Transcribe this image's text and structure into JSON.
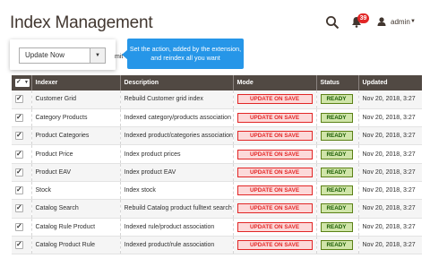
{
  "header": {
    "title": "Index Management",
    "notifications_count": "39",
    "user_name": "admin"
  },
  "actions": {
    "selected": "Update Now",
    "submit_partial": "mit",
    "tooltip": "Set the action, added by the extension, and reindex all you want"
  },
  "grid": {
    "columns": [
      "Indexer",
      "Description",
      "Mode",
      "Status",
      "Updated"
    ],
    "rows": [
      {
        "indexer": "Customer Grid",
        "description": "Rebuild Customer grid index",
        "mode": "UPDATE ON SAVE",
        "status": "READY",
        "updated": "Nov 20, 2018, 3:27"
      },
      {
        "indexer": "Category Products",
        "description": "Indexed category/products association",
        "mode": "UPDATE ON SAVE",
        "status": "READY",
        "updated": "Nov 20, 2018, 3:27"
      },
      {
        "indexer": "Product Categories",
        "description": "Indexed product/categories association",
        "mode": "UPDATE ON SAVE",
        "status": "READY",
        "updated": "Nov 20, 2018, 3:27"
      },
      {
        "indexer": "Product Price",
        "description": "Index product prices",
        "mode": "UPDATE ON SAVE",
        "status": "READY",
        "updated": "Nov 20, 2018, 3:27"
      },
      {
        "indexer": "Product EAV",
        "description": "Index product EAV",
        "mode": "UPDATE ON SAVE",
        "status": "READY",
        "updated": "Nov 20, 2018, 3:27"
      },
      {
        "indexer": "Stock",
        "description": "Index stock",
        "mode": "UPDATE ON SAVE",
        "status": "READY",
        "updated": "Nov 20, 2018, 3:27"
      },
      {
        "indexer": "Catalog Search",
        "description": "Rebuild Catalog product fulltext search",
        "mode": "UPDATE ON SAVE",
        "status": "READY",
        "updated": "Nov 20, 2018, 3:27"
      },
      {
        "indexer": "Catalog Rule Product",
        "description": "Indexed rule/product association",
        "mode": "UPDATE ON SAVE",
        "status": "READY",
        "updated": "Nov 20, 2018, 3:27"
      },
      {
        "indexer": "Catalog Product Rule",
        "description": "Indexed product/rule association",
        "mode": "UPDATE ON SAVE",
        "status": "READY",
        "updated": "Nov 20, 2018, 3:27"
      }
    ]
  },
  "icons": [
    "search-icon",
    "bell-icon",
    "user-icon",
    "chevron-down-icon",
    "checkbox-icon"
  ],
  "colors": {
    "header_bg": "#514943",
    "tooltip_bg": "#2696e8",
    "mode_text": "#e22626",
    "mode_bg": "#fcd9d9",
    "status_text": "#185b00",
    "status_bg": "#d0e5a9",
    "badge_bg": "#e22626"
  }
}
